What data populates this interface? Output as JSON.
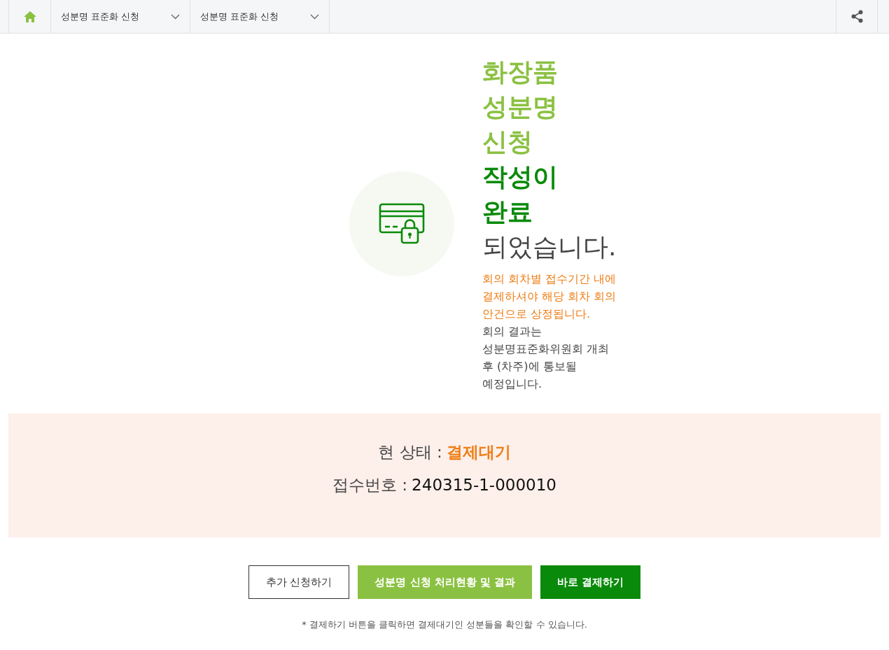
{
  "nav": {
    "breadcrumbs": [
      {
        "label": "성분명 표준화 신청"
      },
      {
        "label": "성분명 표준화 신청"
      }
    ]
  },
  "heading": [
    {
      "text": "화장품",
      "kind": "light"
    },
    {
      "text": "성분명",
      "kind": "light"
    },
    {
      "text": "신청",
      "kind": "light"
    },
    {
      "text": "작성이",
      "kind": "dark"
    },
    {
      "text": "완료",
      "kind": "dark"
    },
    {
      "text": "되었습니다.",
      "kind": "plain"
    }
  ],
  "notice": "회의 회차별 접수기간 내에 결제하셔야 해당 회차 회의 안건으로 상정됩니다.",
  "info": "회의 결과는 성분명표준화위원회 개최 후 (차주)에 통보될 예정입니다.",
  "status": {
    "label": "현 상태 :",
    "value": "결제대기"
  },
  "receipt": {
    "label": "접수번호 :",
    "value": "240315-1-000010"
  },
  "buttons": [
    {
      "label": "추가 신청하기",
      "kind": "outline"
    },
    {
      "label": "성분명 신청 처리현황 및 결과",
      "kind": "light"
    },
    {
      "label": "바로 결제하기",
      "kind": "dark"
    }
  ],
  "footnote": "* 결제하기 버튼을 클릭하면 결제대기인 성분들을 확인할 수 있습니다."
}
